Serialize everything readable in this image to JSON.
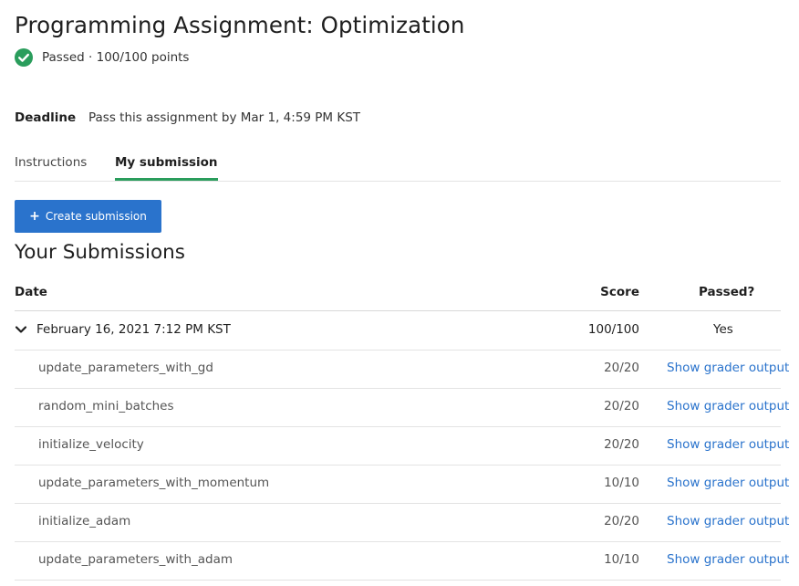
{
  "page": {
    "title": "Programming Assignment: Optimization",
    "status_text": "Passed · 100/100 points",
    "status_color": "#2a9d5c"
  },
  "deadline": {
    "label": "Deadline",
    "text": "Pass this assignment by Mar 1, 4:59 PM KST"
  },
  "tabs": [
    {
      "label": "Instructions",
      "active": false
    },
    {
      "label": "My submission",
      "active": true
    }
  ],
  "create_button": {
    "label": "Create submission",
    "icon": "plus-icon",
    "color": "#2a73cc"
  },
  "submissions": {
    "title": "Your Submissions",
    "headers": {
      "date": "Date",
      "score": "Score",
      "passed": "Passed?"
    },
    "entry": {
      "date": "February 16, 2021 7:12 PM KST",
      "score": "100/100",
      "passed": "Yes",
      "expanded": true
    },
    "parts": [
      {
        "name": "update_parameters_with_gd",
        "score": "20/20",
        "link": "Show grader output"
      },
      {
        "name": "random_mini_batches",
        "score": "20/20",
        "link": "Show grader output"
      },
      {
        "name": "initialize_velocity",
        "score": "20/20",
        "link": "Show grader output"
      },
      {
        "name": "update_parameters_with_momentum",
        "score": "10/10",
        "link": "Show grader output"
      },
      {
        "name": "initialize_adam",
        "score": "20/20",
        "link": "Show grader output"
      },
      {
        "name": "update_parameters_with_adam",
        "score": "10/10",
        "link": "Show grader output"
      }
    ]
  }
}
